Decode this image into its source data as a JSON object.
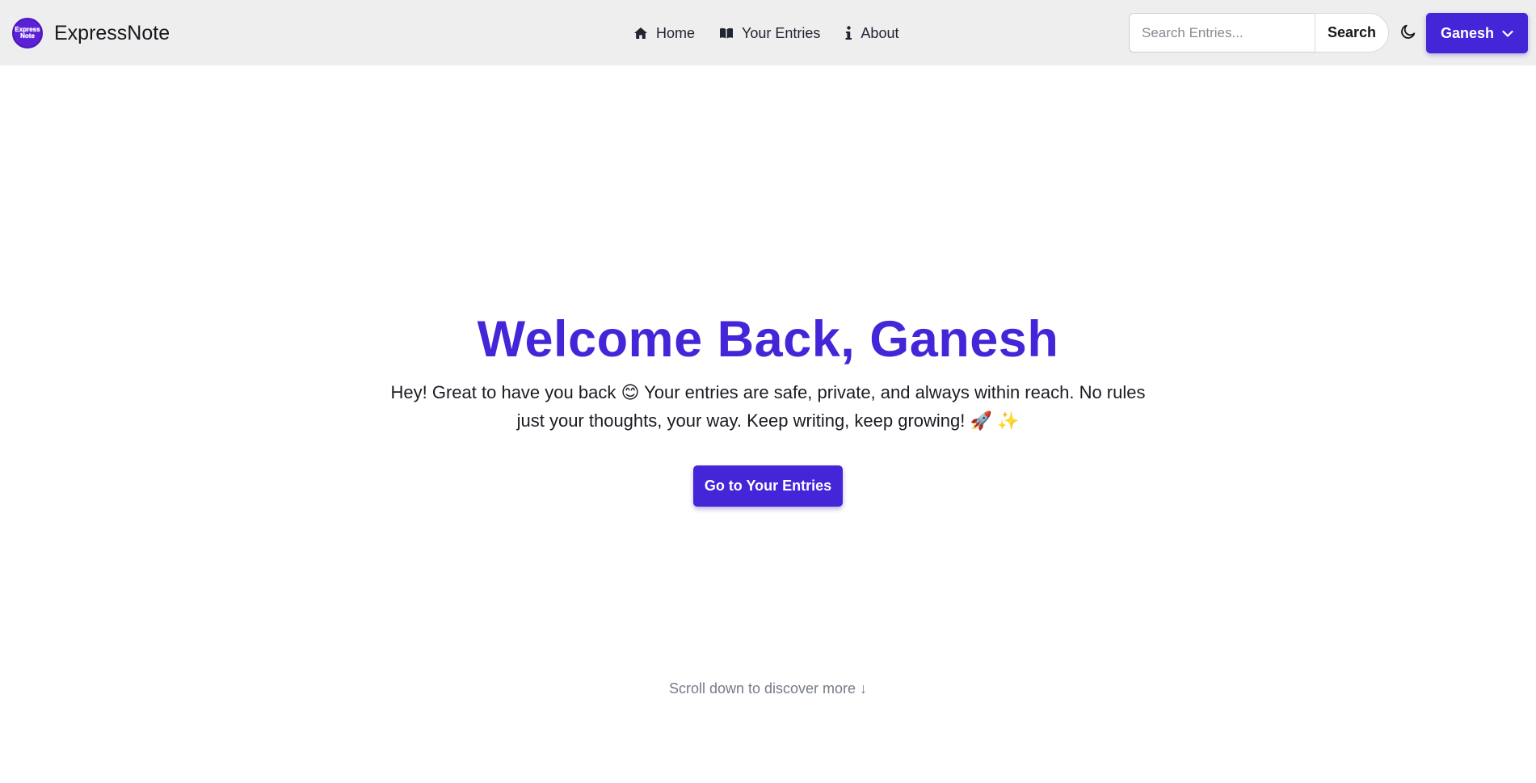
{
  "brand": {
    "logo_line1": "Express",
    "logo_line2": "Note",
    "name": "ExpressNote"
  },
  "nav": {
    "links": [
      {
        "label": "Home",
        "icon": "home-icon"
      },
      {
        "label": "Your Entries",
        "icon": "book-icon"
      },
      {
        "label": "About",
        "icon": "info-icon"
      }
    ]
  },
  "search": {
    "placeholder": "Search Entries...",
    "button_label": "Search"
  },
  "theme_toggle": {
    "icon": "moon-icon"
  },
  "user_menu": {
    "label": "Ganesh",
    "icon": "chevron-down-icon"
  },
  "hero": {
    "title": "Welcome Back, Ganesh",
    "line1": "Hey! Great to have you back 😊 Your entries are safe, private, and always within reach. No rules",
    "line2": "just your thoughts, your way. Keep writing, keep growing! 🚀 ✨",
    "cta_label": "Go to Your Entries"
  },
  "scroll_hint": "Scroll down to discover more ↓",
  "colors": {
    "accent": "#4525d8",
    "navbar_bg": "#eeeeee",
    "muted_text": "#757b86"
  }
}
